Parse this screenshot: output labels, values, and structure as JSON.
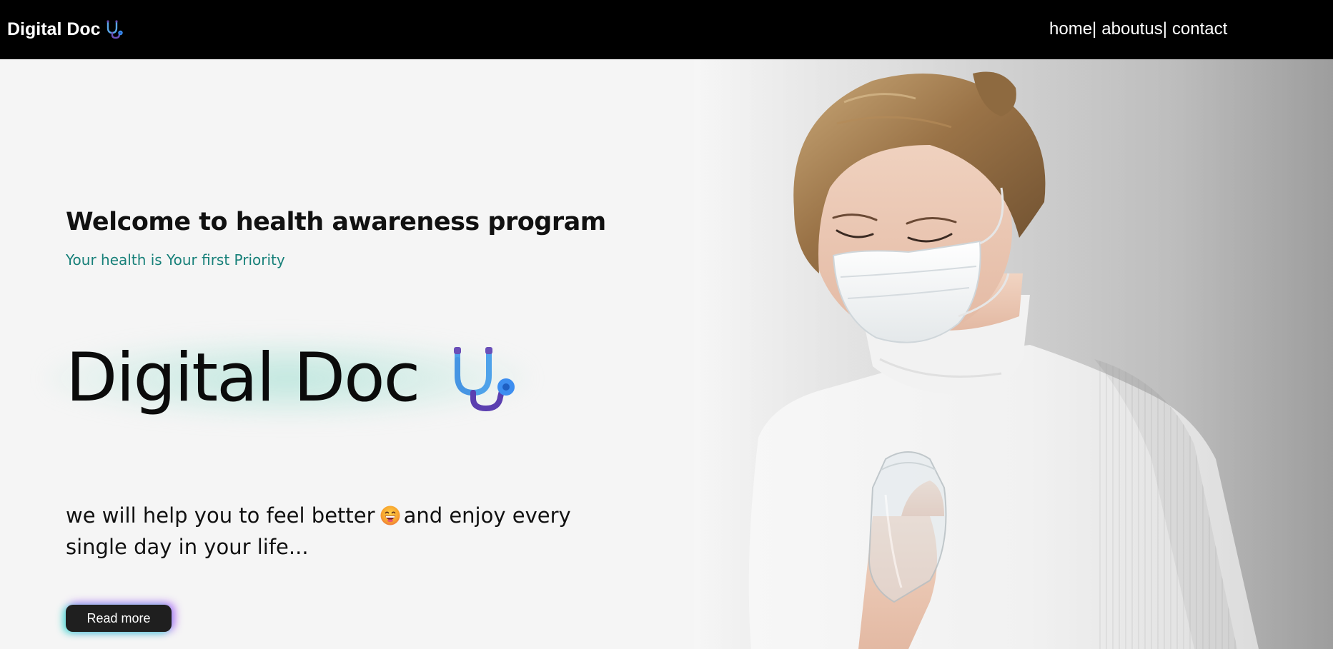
{
  "navbar": {
    "brand_label": "Digital Doc",
    "brand_icon": "stethoscope-icon",
    "links": [
      {
        "label": "home",
        "separator": "|"
      },
      {
        "label": "aboutus",
        "separator": "|"
      },
      {
        "label": "contact",
        "separator": ""
      }
    ]
  },
  "hero": {
    "welcome_heading": "Welcome to health awareness program",
    "tagline": "Your health is Your first Priority",
    "big_title": "Digital Doc",
    "big_title_icon": "stethoscope-icon",
    "description_before": "we will help you to feel better",
    "description_emoji": "grinning-face-emoji",
    "description_after": "and enjoy every single day in your life...",
    "cta_label": "Read more",
    "photo": "woman-in-face-mask-holding-bottle"
  },
  "colors": {
    "navbar_bg": "#000000",
    "page_bg": "#f5f5f5",
    "tagline": "#178079",
    "button_bg": "#1f1f1f",
    "button_glow_left": "#40e0d0",
    "button_glow_right": "#a855f7"
  }
}
